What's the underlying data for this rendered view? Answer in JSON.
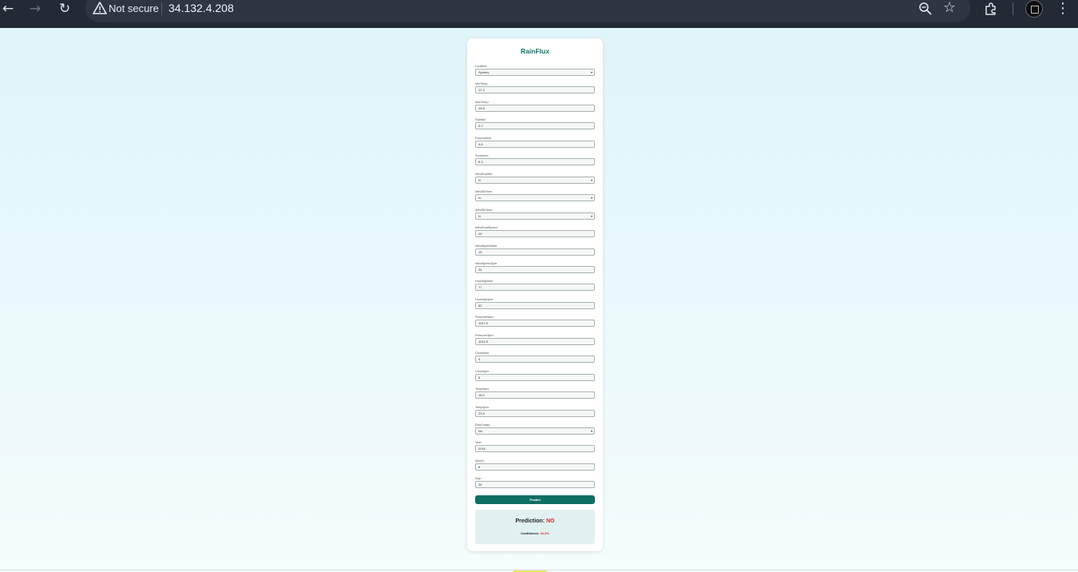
{
  "browser": {
    "security_label": "Not secure",
    "url": "34.132.4.208",
    "icons": [
      "back-icon",
      "forward-icon",
      "reload-icon",
      "warning-icon",
      "zoom-icon",
      "star-icon",
      "extensions-icon",
      "profile-avatar",
      "menu-icon"
    ]
  },
  "colors": {
    "accent": "#0e6f62",
    "title": "#11766a",
    "prediction": "#d42b2b",
    "page_bg": "#e2f6f8"
  },
  "app": {
    "title": "RainFlux",
    "predict_label": "Predict",
    "prediction_label": "Prediction:",
    "prediction_value": "NO",
    "confidence_label": "Confidence:",
    "confidence_value": "44.2%"
  },
  "fields": [
    {
      "label": "Location:",
      "value": "Sydney",
      "type": "select"
    },
    {
      "label": "MinTemp:",
      "value": "12.3",
      "type": "input"
    },
    {
      "label": "MaxTemp:",
      "value": "24.8",
      "type": "input"
    },
    {
      "label": "Rainfall:",
      "value": "0.2",
      "type": "input"
    },
    {
      "label": "Evaporation:",
      "value": "4.8",
      "type": "input"
    },
    {
      "label": "Sunshine:",
      "value": "8.3",
      "type": "input"
    },
    {
      "label": "WindGustDir:",
      "value": "N",
      "type": "select"
    },
    {
      "label": "WindDir9am:",
      "value": "N",
      "type": "select"
    },
    {
      "label": "WindDir3pm:",
      "value": "N",
      "type": "select"
    },
    {
      "label": "WindGustSpeed:",
      "value": "44",
      "type": "input"
    },
    {
      "label": "WindSpeed9am:",
      "value": "13",
      "type": "input"
    },
    {
      "label": "WindSpeed3pm:",
      "value": "24",
      "type": "input"
    },
    {
      "label": "Humidity9am:",
      "value": "77",
      "type": "input"
    },
    {
      "label": "Humidity3pm:",
      "value": "82",
      "type": "input"
    },
    {
      "label": "Pressure9am:",
      "value": "1017.0",
      "type": "input"
    },
    {
      "label": "Pressure3pm:",
      "value": "1012.9",
      "type": "input"
    },
    {
      "label": "Cloud9am:",
      "value": "4",
      "type": "input"
    },
    {
      "label": "Cloud3pm:",
      "value": "6",
      "type": "input"
    },
    {
      "label": "Temp9am:",
      "value": "16.0",
      "type": "input"
    },
    {
      "label": "Temp3pm:",
      "value": "23.6",
      "type": "input"
    },
    {
      "label": "RainToday:",
      "value": "No",
      "type": "select"
    },
    {
      "label": "Year:",
      "value": "2016",
      "type": "input"
    },
    {
      "label": "Month:",
      "value": "8",
      "type": "input"
    },
    {
      "label": "Day:",
      "value": "24",
      "type": "input"
    }
  ]
}
